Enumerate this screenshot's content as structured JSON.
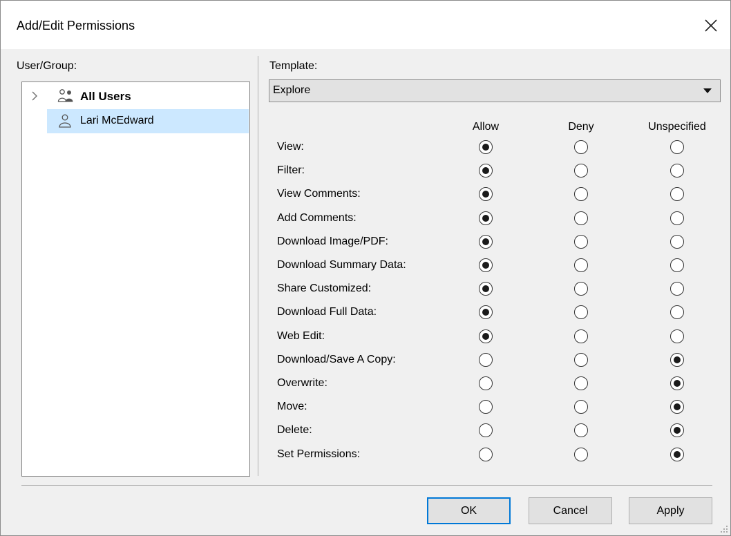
{
  "window": {
    "title": "Add/Edit Permissions"
  },
  "users_panel": {
    "label": "User/Group:",
    "items": [
      {
        "label": "All Users",
        "icon": "group-icon",
        "expandable": true,
        "selected": false
      },
      {
        "label": "Lari McEdward",
        "icon": "user-icon",
        "expandable": false,
        "selected": true
      }
    ]
  },
  "template": {
    "label": "Template:",
    "value": "Explore"
  },
  "columns": [
    "Allow",
    "Deny",
    "Unspecified"
  ],
  "permissions": [
    {
      "label": "View:",
      "value": "Allow"
    },
    {
      "label": "Filter:",
      "value": "Allow"
    },
    {
      "label": "View Comments:",
      "value": "Allow"
    },
    {
      "label": "Add Comments:",
      "value": "Allow"
    },
    {
      "label": "Download Image/PDF:",
      "value": "Allow"
    },
    {
      "label": "Download Summary Data:",
      "value": "Allow"
    },
    {
      "label": "Share Customized:",
      "value": "Allow"
    },
    {
      "label": "Download Full Data:",
      "value": "Allow"
    },
    {
      "label": "Web Edit:",
      "value": "Allow"
    },
    {
      "label": "Download/Save A Copy:",
      "value": "Unspecified"
    },
    {
      "label": "Overwrite:",
      "value": "Unspecified"
    },
    {
      "label": "Move:",
      "value": "Unspecified"
    },
    {
      "label": "Delete:",
      "value": "Unspecified"
    },
    {
      "label": "Set Permissions:",
      "value": "Unspecified"
    }
  ],
  "buttons": {
    "ok": "OK",
    "cancel": "Cancel",
    "apply": "Apply"
  },
  "colors": {
    "selection": "#cce8ff",
    "default_button_border": "#0078d7"
  }
}
